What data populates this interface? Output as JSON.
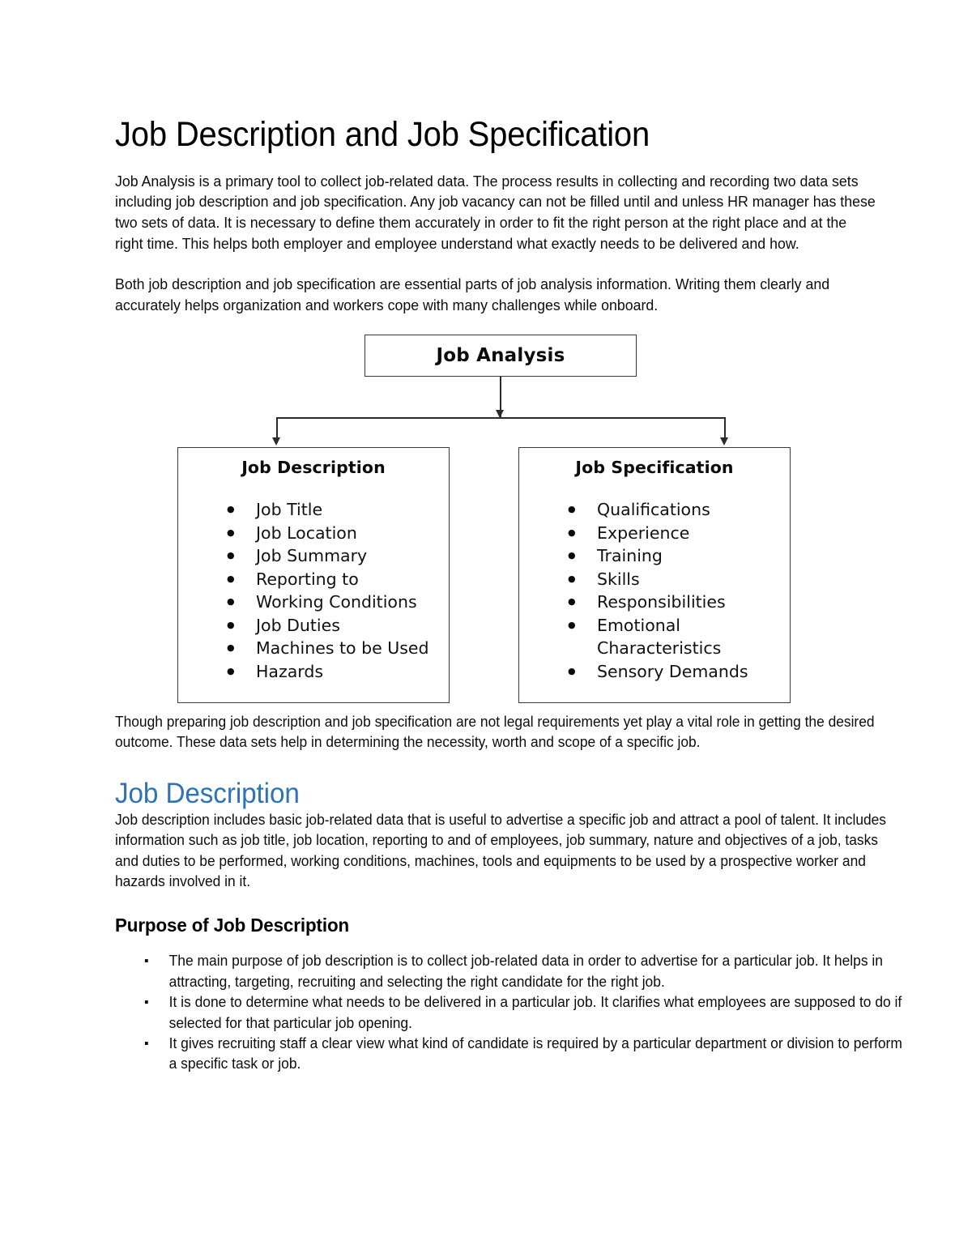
{
  "document": {
    "title": "Job Description and Job Specification",
    "intro_paragraphs": [
      "Job Analysis is a primary tool to collect job-related data. The process results in collecting and recording two data sets including job description and job specification. Any job vacancy can not be filled until and unless HR manager has these two sets of data. It is necessary to define them accurately in order to fit the right person at the right place and at the right time. This helps both employer and employee understand what exactly needs to be delivered and how.",
      "Both job description and job specification are essential parts of job analysis information. Writing them clearly and accurately helps organization and workers cope with many challenges while onboard."
    ],
    "after_diagram_paragraph": "Though preparing job description and job specification are not legal requirements yet play a vital role in getting the desired outcome. These data sets help in determining the necessity, worth and scope of a specific job.",
    "section_heading": "Job Description",
    "section_heading_color": "#2E74B5",
    "section_paragraph": "Job description includes basic job-related data that is useful to advertise a specific job and attract a pool of talent. It includes information such as job title, job location, reporting to and of employees, job summary, nature and objectives of a job, tasks and duties to be performed, working conditions, machines, tools and equipments to be used by a prospective worker and hazards involved in it.",
    "subsection_heading": "Purpose of Job Description",
    "purpose_bullets": [
      "The main purpose of job description is to collect job-related data in order to advertise for a particular job. It helps in attracting, targeting, recruiting and selecting the right candidate for the right job.",
      "It is done to determine what needs to be delivered in a particular job. It clarifies what employees are supposed to do if selected for that particular job opening.",
      "It gives recruiting staff a clear view what kind of candidate is required by a particular department or division to perform a specific task or job."
    ]
  },
  "diagram": {
    "root": {
      "label": "Job Analysis"
    },
    "children": [
      {
        "label": "Job Description",
        "items": [
          "Job Title",
          "Job Location",
          "Job Summary",
          "Reporting to",
          "Working Conditions",
          "Job Duties",
          "Machines to be Used",
          "Hazards"
        ]
      },
      {
        "label": "Job Specification",
        "items": [
          "Qualifications",
          "Experience",
          "Training",
          "Skills",
          "Responsibilities",
          "Emotional Characteristics",
          "Sensory Demands"
        ]
      }
    ],
    "border_color": "#3A3A3A",
    "connector_color": "#2B2B2B"
  }
}
